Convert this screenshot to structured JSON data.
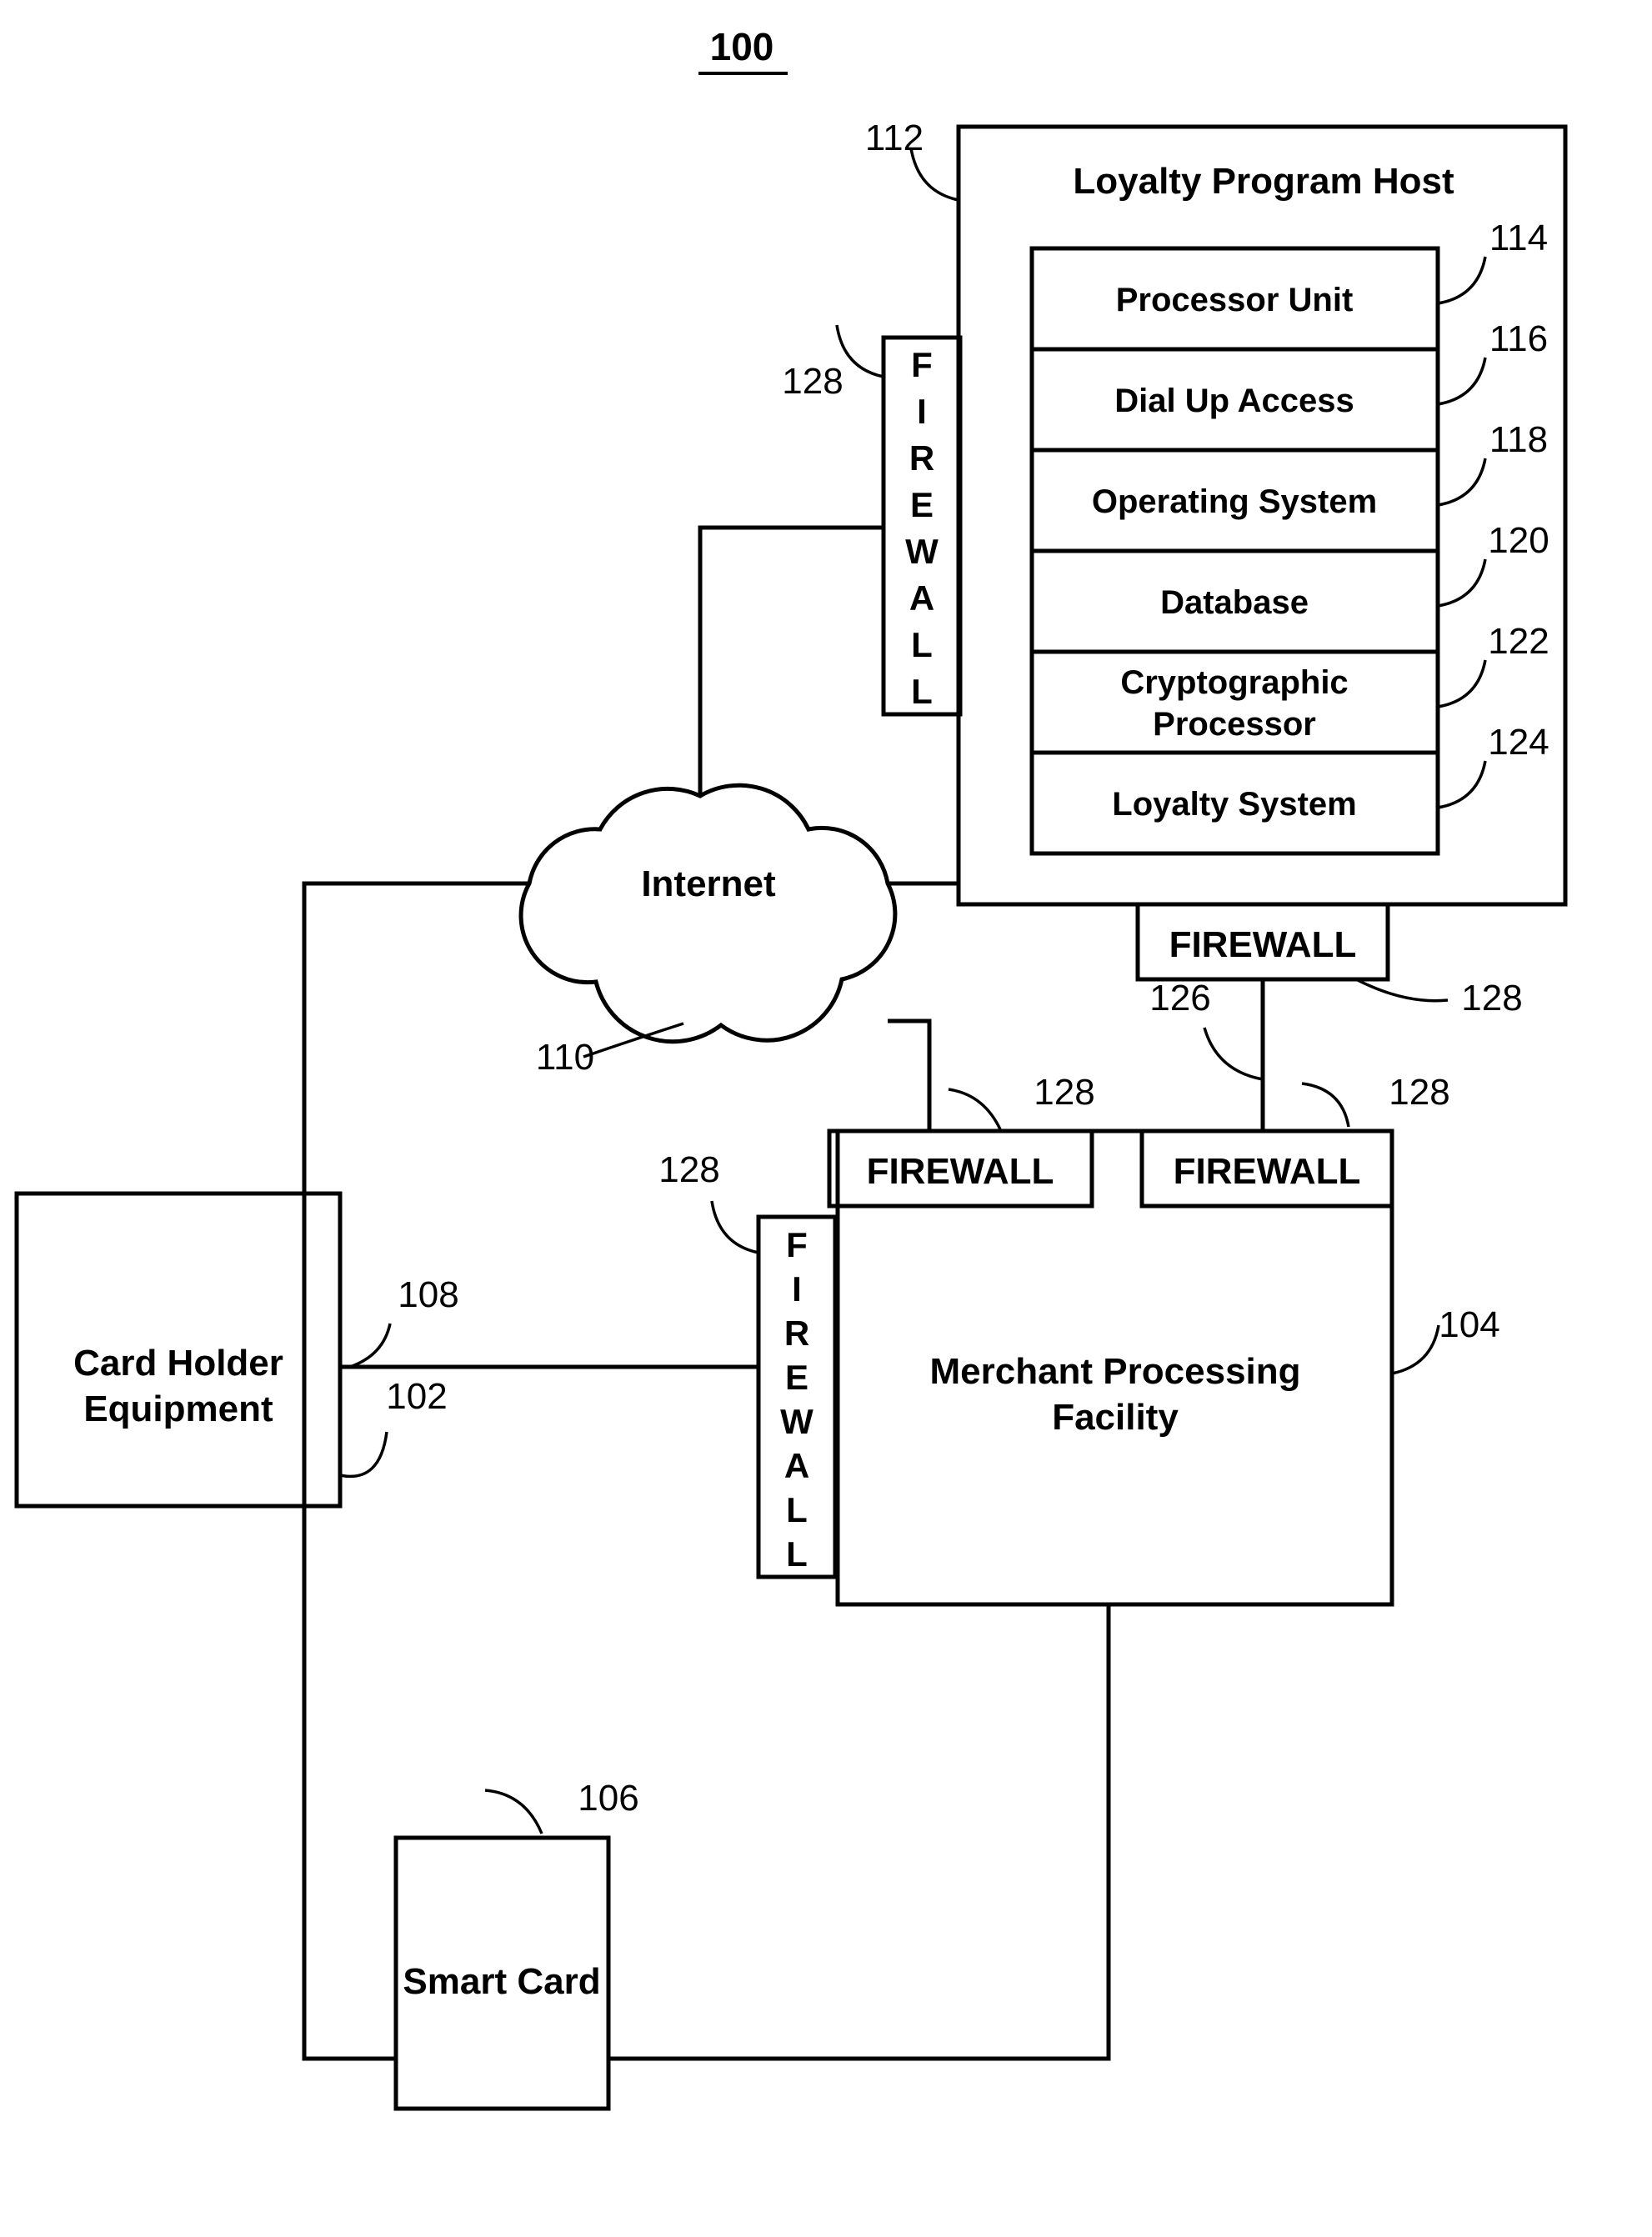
{
  "figure": {
    "number": "100",
    "title_underlined": true
  },
  "nodes": {
    "loyalty_host": {
      "label": "Loyalty Program Host",
      "ref": "112",
      "modules": [
        {
          "label": "Processor Unit",
          "ref": "114"
        },
        {
          "label": "Dial Up Access",
          "ref": "116"
        },
        {
          "label": "Operating System",
          "ref": "118"
        },
        {
          "label": "Database",
          "ref": "120"
        },
        {
          "label": "Cryptographic Processor",
          "ref": "122",
          "line1": "Cryptographic",
          "line2": "Processor"
        },
        {
          "label": "Loyalty System",
          "ref": "124"
        }
      ]
    },
    "internet": {
      "label": "Internet",
      "ref": "110"
    },
    "card_holder": {
      "label": "Card Holder Equipment",
      "line1": "Card Holder",
      "line2": "Equipment",
      "ref": "102"
    },
    "merchant": {
      "label": "Merchant Processing Facility",
      "line1": "Merchant Processing",
      "line2": "Facility",
      "ref": "104"
    },
    "smart_card": {
      "label": "Smart Card",
      "ref": "106"
    }
  },
  "firewalls": {
    "label": "FIREWALL",
    "vertical_letters": [
      "F",
      "I",
      "R",
      "E",
      "W",
      "A",
      "L",
      "L"
    ],
    "instances": [
      {
        "id": "host-left-vertical",
        "orientation": "vertical",
        "ref": "128"
      },
      {
        "id": "host-bottom",
        "orientation": "horizontal",
        "ref": "128"
      },
      {
        "id": "merchant-top-left",
        "orientation": "horizontal",
        "ref": "128"
      },
      {
        "id": "merchant-top-right",
        "orientation": "horizontal",
        "ref": "128"
      },
      {
        "id": "merchant-left-vertical",
        "orientation": "vertical",
        "ref": "128"
      }
    ]
  },
  "links": [
    {
      "id": "card-holder-to-merchant-firewall",
      "ref": "108"
    },
    {
      "id": "host-firewall-to-merchant-firewall",
      "ref": "126"
    }
  ],
  "reference_numerals": {
    "fig": "100",
    "card_holder": "102",
    "merchant": "104",
    "smart_card": "106",
    "link_108": "108",
    "internet": "110",
    "loyalty_host": "112",
    "processor_unit": "114",
    "dial_up_access": "116",
    "operating_system": "118",
    "database": "120",
    "cryptographic_processor": "122",
    "loyalty_system": "124",
    "link_126": "126",
    "firewall": "128"
  },
  "colors": {
    "stroke": "#000000",
    "background": "#ffffff"
  }
}
